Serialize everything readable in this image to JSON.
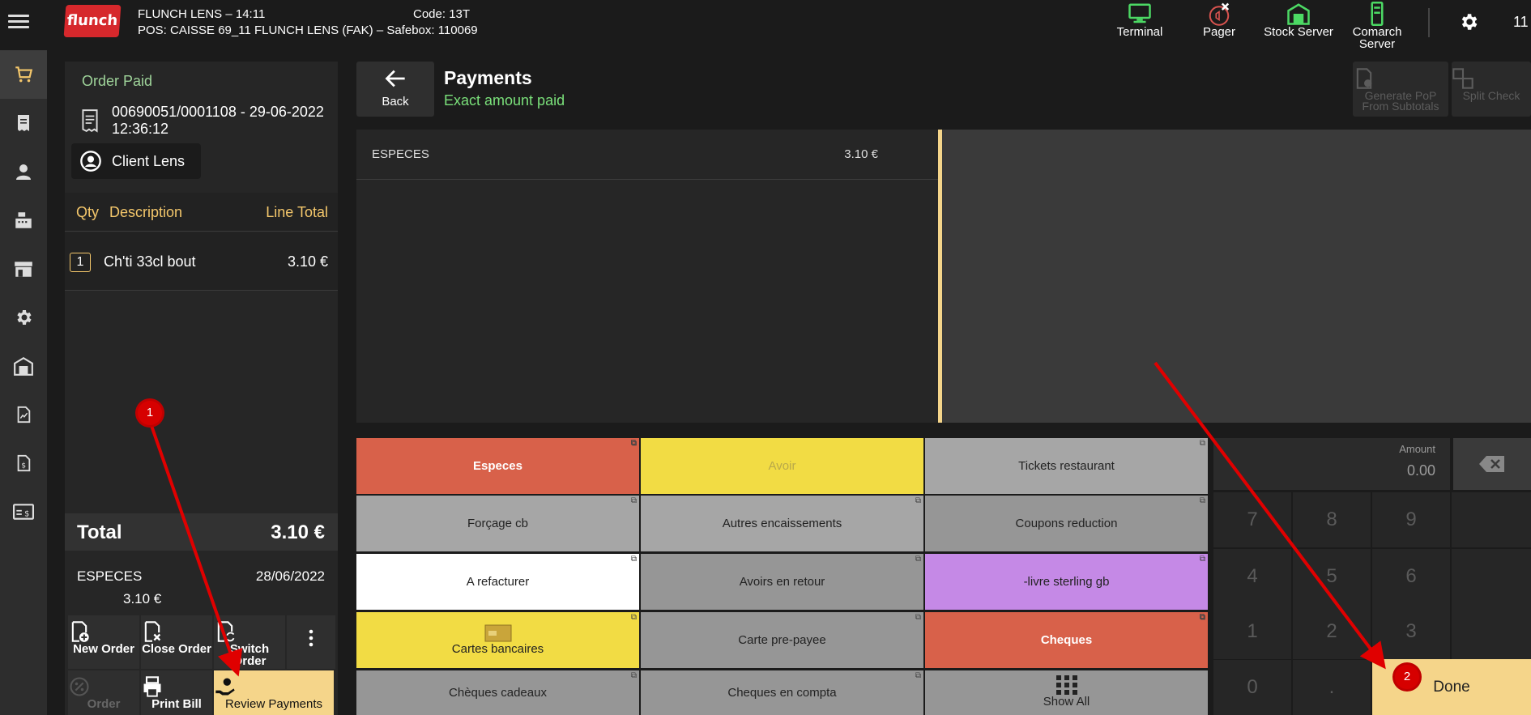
{
  "topbar": {
    "logo": "flunch",
    "store_line1": "FLUNCH LENS – 14:11",
    "code": "Code: 13T",
    "store_line2": "POS: CAISSE 69_11 FLUNCH LENS (FAK) – Safebox: 110069",
    "buttons": [
      {
        "label": "Terminal",
        "icon": "monitor-icon",
        "color": "#4cd964"
      },
      {
        "label": "Pager",
        "icon": "pager-icon",
        "color": "#d9534f"
      },
      {
        "label": "Stock Server",
        "icon": "warehouse-icon",
        "color": "#4cd964"
      },
      {
        "label": "Comarch Server",
        "icon": "server-icon",
        "color": "#4cd964"
      }
    ],
    "clock_partial": "11"
  },
  "nav": [
    "cart-icon",
    "receipt-icon",
    "person-icon",
    "cash-register-icon",
    "store-icon",
    "settings-icon",
    "warehouse-icon",
    "report-icon",
    "invoice-icon",
    "card-icon"
  ],
  "order": {
    "status": "Order Paid",
    "order_id": "00690051/0001108 - 29-06-2022 12:36:12",
    "client": "Client Lens",
    "columns": {
      "qty": "Qty",
      "desc": "Description",
      "total": "Line Total"
    },
    "lines": [
      {
        "qty": "1",
        "desc": "Ch'ti 33cl bout",
        "total": "3.10 €"
      }
    ],
    "total_label": "Total",
    "total_value": "3.10 €",
    "payment": {
      "method": "ESPECES",
      "date": "28/06/2022",
      "amount": "3.10 €"
    },
    "actions": {
      "new_order": "New Order",
      "close_order": "Close Order",
      "switch_order": "Switch Order",
      "order_discount": "Order",
      "print_bill": "Print Bill",
      "review_payments": "Review Payments"
    }
  },
  "payments": {
    "back": "Back",
    "title": "Payments",
    "subtitle": "Exact amount paid",
    "tools": {
      "pop": "Generate PoP From Subtotals",
      "split": "Split Check"
    },
    "entries": [
      {
        "method": "ESPECES",
        "amount": "3.10 €"
      }
    ],
    "methods": [
      [
        "Especes",
        "Avoir",
        "Tickets restaurant"
      ],
      [
        "Forçage cb",
        "Autres encaissements",
        "Coupons reduction"
      ],
      [
        "A refacturer",
        "Avoirs en retour",
        "-livre sterling gb"
      ],
      [
        "Cartes bancaires",
        "Carte pre-payee",
        "Cheques"
      ],
      [
        "Chèques cadeaux",
        "Cheques en compta",
        "Show All"
      ]
    ],
    "amount_label": "Amount",
    "amount_value": "0.00",
    "keys": {
      "k7": "7",
      "k8": "8",
      "k9": "9",
      "k4": "4",
      "k5": "5",
      "k6": "6",
      "k1": "1",
      "k2": "2",
      "k3": "3",
      "k0": "0",
      "kdot": "."
    },
    "done": "Done"
  },
  "annotations": {
    "badge1": "1",
    "badge2": "2",
    "color": "#e00000"
  }
}
